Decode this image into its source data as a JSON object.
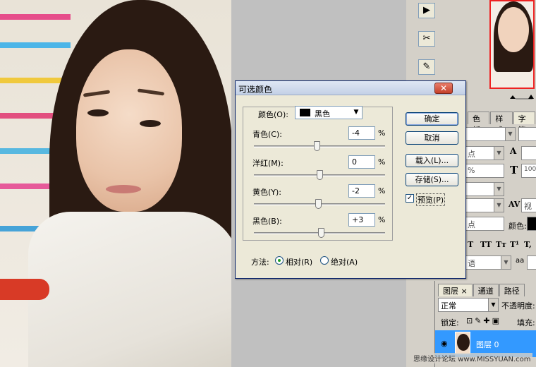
{
  "dialog": {
    "title": "可选颜色",
    "close_glyph": "✕",
    "colors_label": "颜色(O):",
    "colors_value": "黑色",
    "sliders": [
      {
        "label": "青色(C):",
        "value": "-4",
        "unit": "%",
        "level": -4
      },
      {
        "label": "洋红(M):",
        "value": "0",
        "unit": "%",
        "level": 0
      },
      {
        "label": "黄色(Y):",
        "value": "-2",
        "unit": "%",
        "level": -2
      },
      {
        "label": "黑色(B):",
        "value": "+3",
        "unit": "%",
        "level": 3
      }
    ],
    "method_label": "方法:",
    "method_options": [
      "相对(R)",
      "绝对(A)"
    ],
    "method_selected": "相对(R)",
    "buttons": {
      "ok": "确定",
      "cancel": "取消",
      "load": "载入(L)...",
      "save": "存储(S)..."
    },
    "preview_label": "预览(P)",
    "preview_checked": true
  },
  "tools_icons": [
    "play-icon",
    "tools-icon",
    "brush-icon"
  ],
  "char_panel": {
    "tabs": [
      "色板",
      "样式",
      "字符"
    ],
    "size_unit": "点",
    "percent": "%",
    "font_color_label": "颜色:",
    "language": "语",
    "aa_label": "a",
    "track_value": "100",
    "view_label": "视",
    "type_buttons": [
      "T",
      "TT",
      "Tт",
      "T¹",
      "T,"
    ]
  },
  "layers": {
    "tabs": [
      "图层",
      "通道",
      "路径"
    ],
    "close_tab_glyph": "×",
    "blend_mode": "正常",
    "opacity_label": "不透明度:",
    "lock_label": "锁定:",
    "fill_label": "填充:",
    "layer_name": "图层 0"
  },
  "watermark": "思缘设计论坛 www.MISSYUAN.com",
  "colors": {
    "accent": "#3399ff",
    "close_red": "#c4402a",
    "preview_check": "#1c5180"
  }
}
